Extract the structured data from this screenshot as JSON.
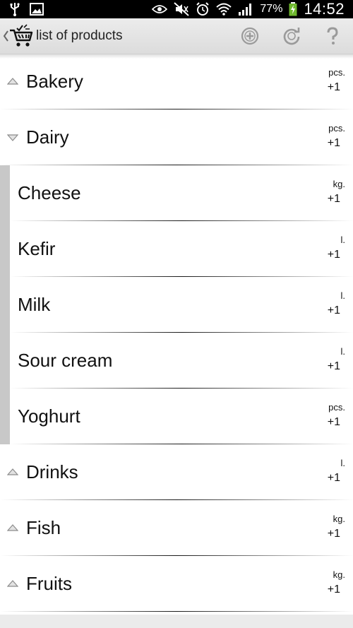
{
  "status_bar": {
    "battery_percent": "77%",
    "time": "14:52"
  },
  "action_bar": {
    "title": "list of products",
    "icons": [
      "usb-icon",
      "image-icon",
      "eye-icon",
      "mute-icon",
      "alarm-icon",
      "wifi-icon",
      "signal-icon",
      "battery-charging-icon",
      "cart-logo-icon",
      "add-icon",
      "refresh-icon",
      "help-icon"
    ]
  },
  "items": [
    {
      "name": "Bakery",
      "unit": "pcs.",
      "qty": "+1",
      "type": "category",
      "state": "collapsed"
    },
    {
      "name": "Dairy",
      "unit": "pcs.",
      "qty": "+1",
      "type": "category",
      "state": "expanded"
    },
    {
      "name": "Cheese",
      "unit": "kg.",
      "qty": "+1",
      "type": "product"
    },
    {
      "name": "Kefir",
      "unit": "l.",
      "qty": "+1",
      "type": "product"
    },
    {
      "name": "Milk",
      "unit": "l.",
      "qty": "+1",
      "type": "product"
    },
    {
      "name": "Sour cream",
      "unit": "l.",
      "qty": "+1",
      "type": "product"
    },
    {
      "name": "Yoghurt",
      "unit": "pcs.",
      "qty": "+1",
      "type": "product"
    },
    {
      "name": "Drinks",
      "unit": "l.",
      "qty": "+1",
      "type": "category",
      "state": "collapsed"
    },
    {
      "name": "Fish",
      "unit": "kg.",
      "qty": "+1",
      "type": "category",
      "state": "collapsed"
    },
    {
      "name": "Fruits",
      "unit": "kg.",
      "qty": "+1",
      "type": "category",
      "state": "collapsed"
    }
  ]
}
